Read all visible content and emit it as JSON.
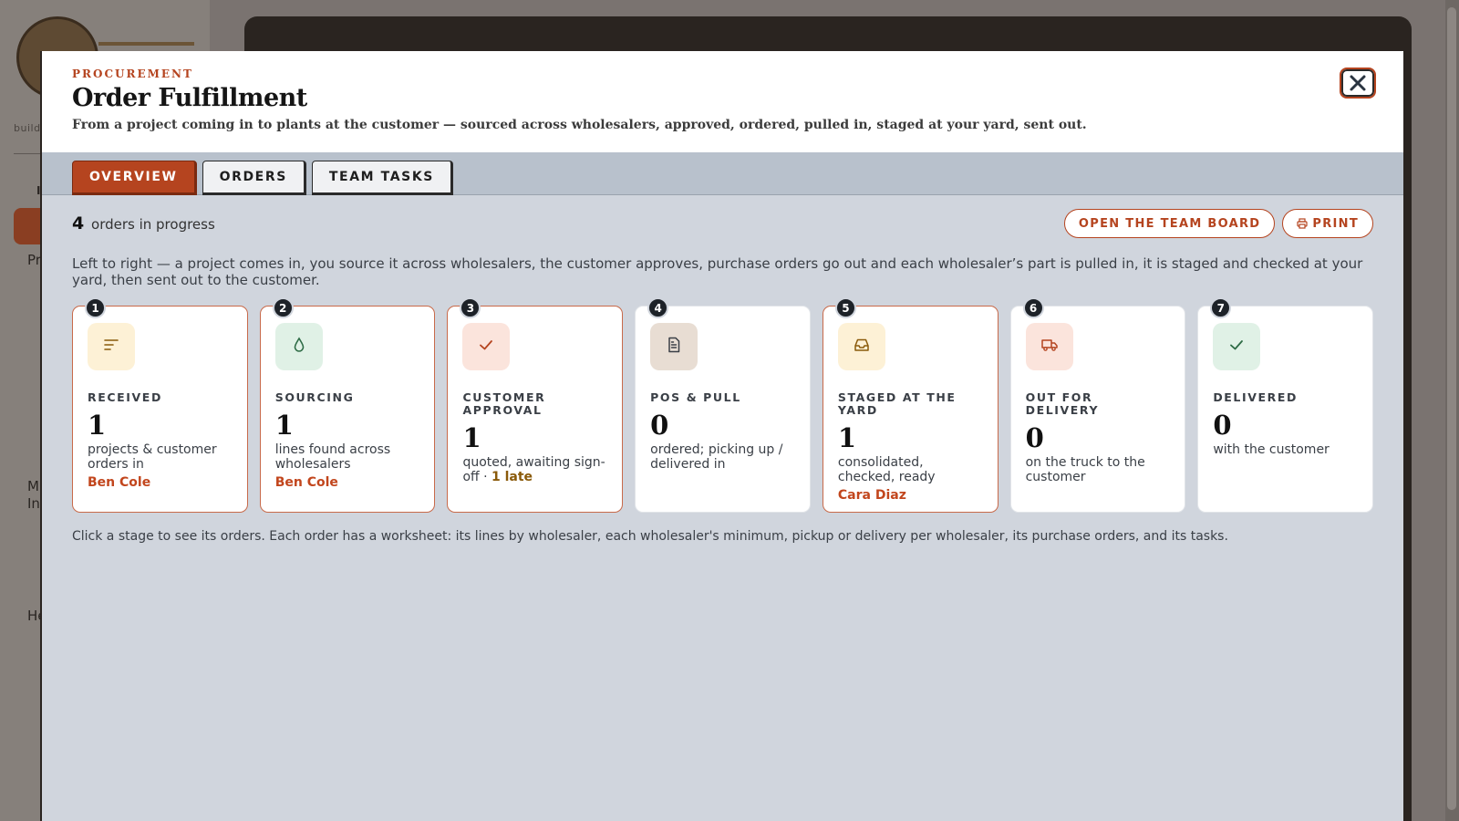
{
  "background": {
    "sidebar_tag": "build",
    "sidebar_letter": "I",
    "sidebar_items": [
      "Pr",
      "M",
      "In",
      "He"
    ]
  },
  "modal": {
    "eyebrow": "PROCUREMENT",
    "title": "Order Fulfillment",
    "subtitle": "From a project coming in to plants at the customer — sourced across wholesalers, approved, ordered, pulled in, staged at your yard, sent out.",
    "close_icon": "close-icon"
  },
  "tabs": [
    {
      "label": "OVERVIEW",
      "active": true
    },
    {
      "label": "ORDERS",
      "active": false
    },
    {
      "label": "TEAM TASKS",
      "active": false
    }
  ],
  "overview": {
    "count": "4",
    "count_label": "orders in progress",
    "open_board_label": "OPEN THE TEAM BOARD",
    "print_label": "PRINT",
    "intro": "Left to right — a project comes in, you source it across wholesalers, the customer approves, purchase orders go out and each wholesaler’s part is pulled in, it is staged and checked at your yard, then sent out to the customer.",
    "footnote": "Click a stage to see its orders. Each order has a worksheet: its lines by wholesaler, each wholesaler's minimum, pickup or delivery per wholesaler, its purchase orders, and its tasks."
  },
  "stages": [
    {
      "num": "1",
      "label": "RECEIVED",
      "count": "1",
      "desc": "projects & customer orders in",
      "late": "",
      "owner": "Ben Cole",
      "icon": "lines-icon",
      "bg": "#fdf1d6",
      "fg": "#8a5a0a",
      "hot": true
    },
    {
      "num": "2",
      "label": "SOURCING",
      "count": "1",
      "desc": "lines found across wholesalers",
      "late": "",
      "owner": "Ben Cole",
      "icon": "drop-icon",
      "bg": "#e0f1e6",
      "fg": "#2d6b45",
      "hot": true
    },
    {
      "num": "3",
      "label": "CUSTOMER APPROVAL",
      "count": "1",
      "desc": "quoted, awaiting sign-off · ",
      "late": "1 late",
      "owner": "",
      "icon": "check-icon",
      "bg": "#fbe4dc",
      "fg": "#b5441f",
      "hot": true
    },
    {
      "num": "4",
      "label": "POS & PULL",
      "count": "0",
      "desc": "ordered; picking up / delivered in",
      "late": "",
      "owner": "",
      "icon": "document-icon",
      "bg": "#e8ddd3",
      "fg": "#3a3f46",
      "hot": false
    },
    {
      "num": "5",
      "label": "STAGED AT THE YARD",
      "count": "1",
      "desc": "consolidated, checked, ready",
      "late": "",
      "owner": "Cara Diaz",
      "icon": "inbox-icon",
      "bg": "#fdf1d6",
      "fg": "#8a5a0a",
      "hot": true
    },
    {
      "num": "6",
      "label": "OUT FOR DELIVERY",
      "count": "0",
      "desc": "on the truck to the customer",
      "late": "",
      "owner": "",
      "icon": "truck-icon",
      "bg": "#fbe4dc",
      "fg": "#b5441f",
      "hot": false
    },
    {
      "num": "7",
      "label": "DELIVERED",
      "count": "0",
      "desc": "with the customer",
      "late": "",
      "owner": "",
      "icon": "check-icon",
      "bg": "#e0f1e6",
      "fg": "#2d6b45",
      "hot": false
    }
  ]
}
